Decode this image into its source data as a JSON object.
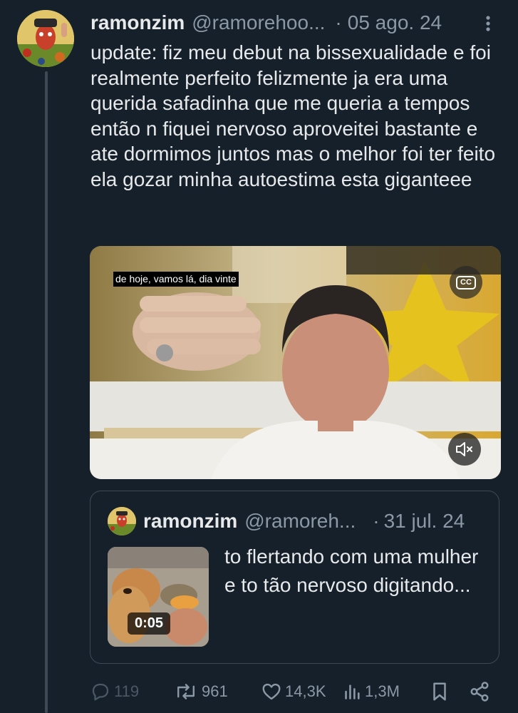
{
  "tweet": {
    "display_name": "ramonzim",
    "handle": "@ramorehoo...",
    "separator": "·",
    "date": "05 ago. 24",
    "text": "update: fiz meu debut na bissexualidade e foi realmente perfeito felizmente ja era uma querida safadinha que me queria a tempos então n fiquei nervoso aproveitei bastante e ate dormimos juntos mas o melhor foi ter feito ela gozar minha autoestima esta giganteee",
    "video": {
      "caption": "de hoje, vamos lá, dia vinte",
      "cc_label": "CC",
      "muted": true,
      "icons": [
        "cc-icon",
        "muted-speaker-icon"
      ]
    }
  },
  "quoted_tweet": {
    "display_name": "ramonzim",
    "handle": "@ramoreh...",
    "separator": "·",
    "date": "31 jul. 24",
    "text": "to flertando com uma mulher e to tão  nervoso digitando...",
    "video_duration": "0:05"
  },
  "actions": {
    "replies": "119",
    "reposts": "961",
    "likes": "14,3K",
    "views": "1,3M",
    "icons": [
      "reply-icon",
      "repost-icon",
      "like-icon",
      "views-icon",
      "bookmark-icon",
      "share-icon"
    ]
  },
  "colors": {
    "background": "#15202b",
    "text": "#e7e9ea",
    "muted": "#8b98a5",
    "border": "#3d4a56"
  }
}
